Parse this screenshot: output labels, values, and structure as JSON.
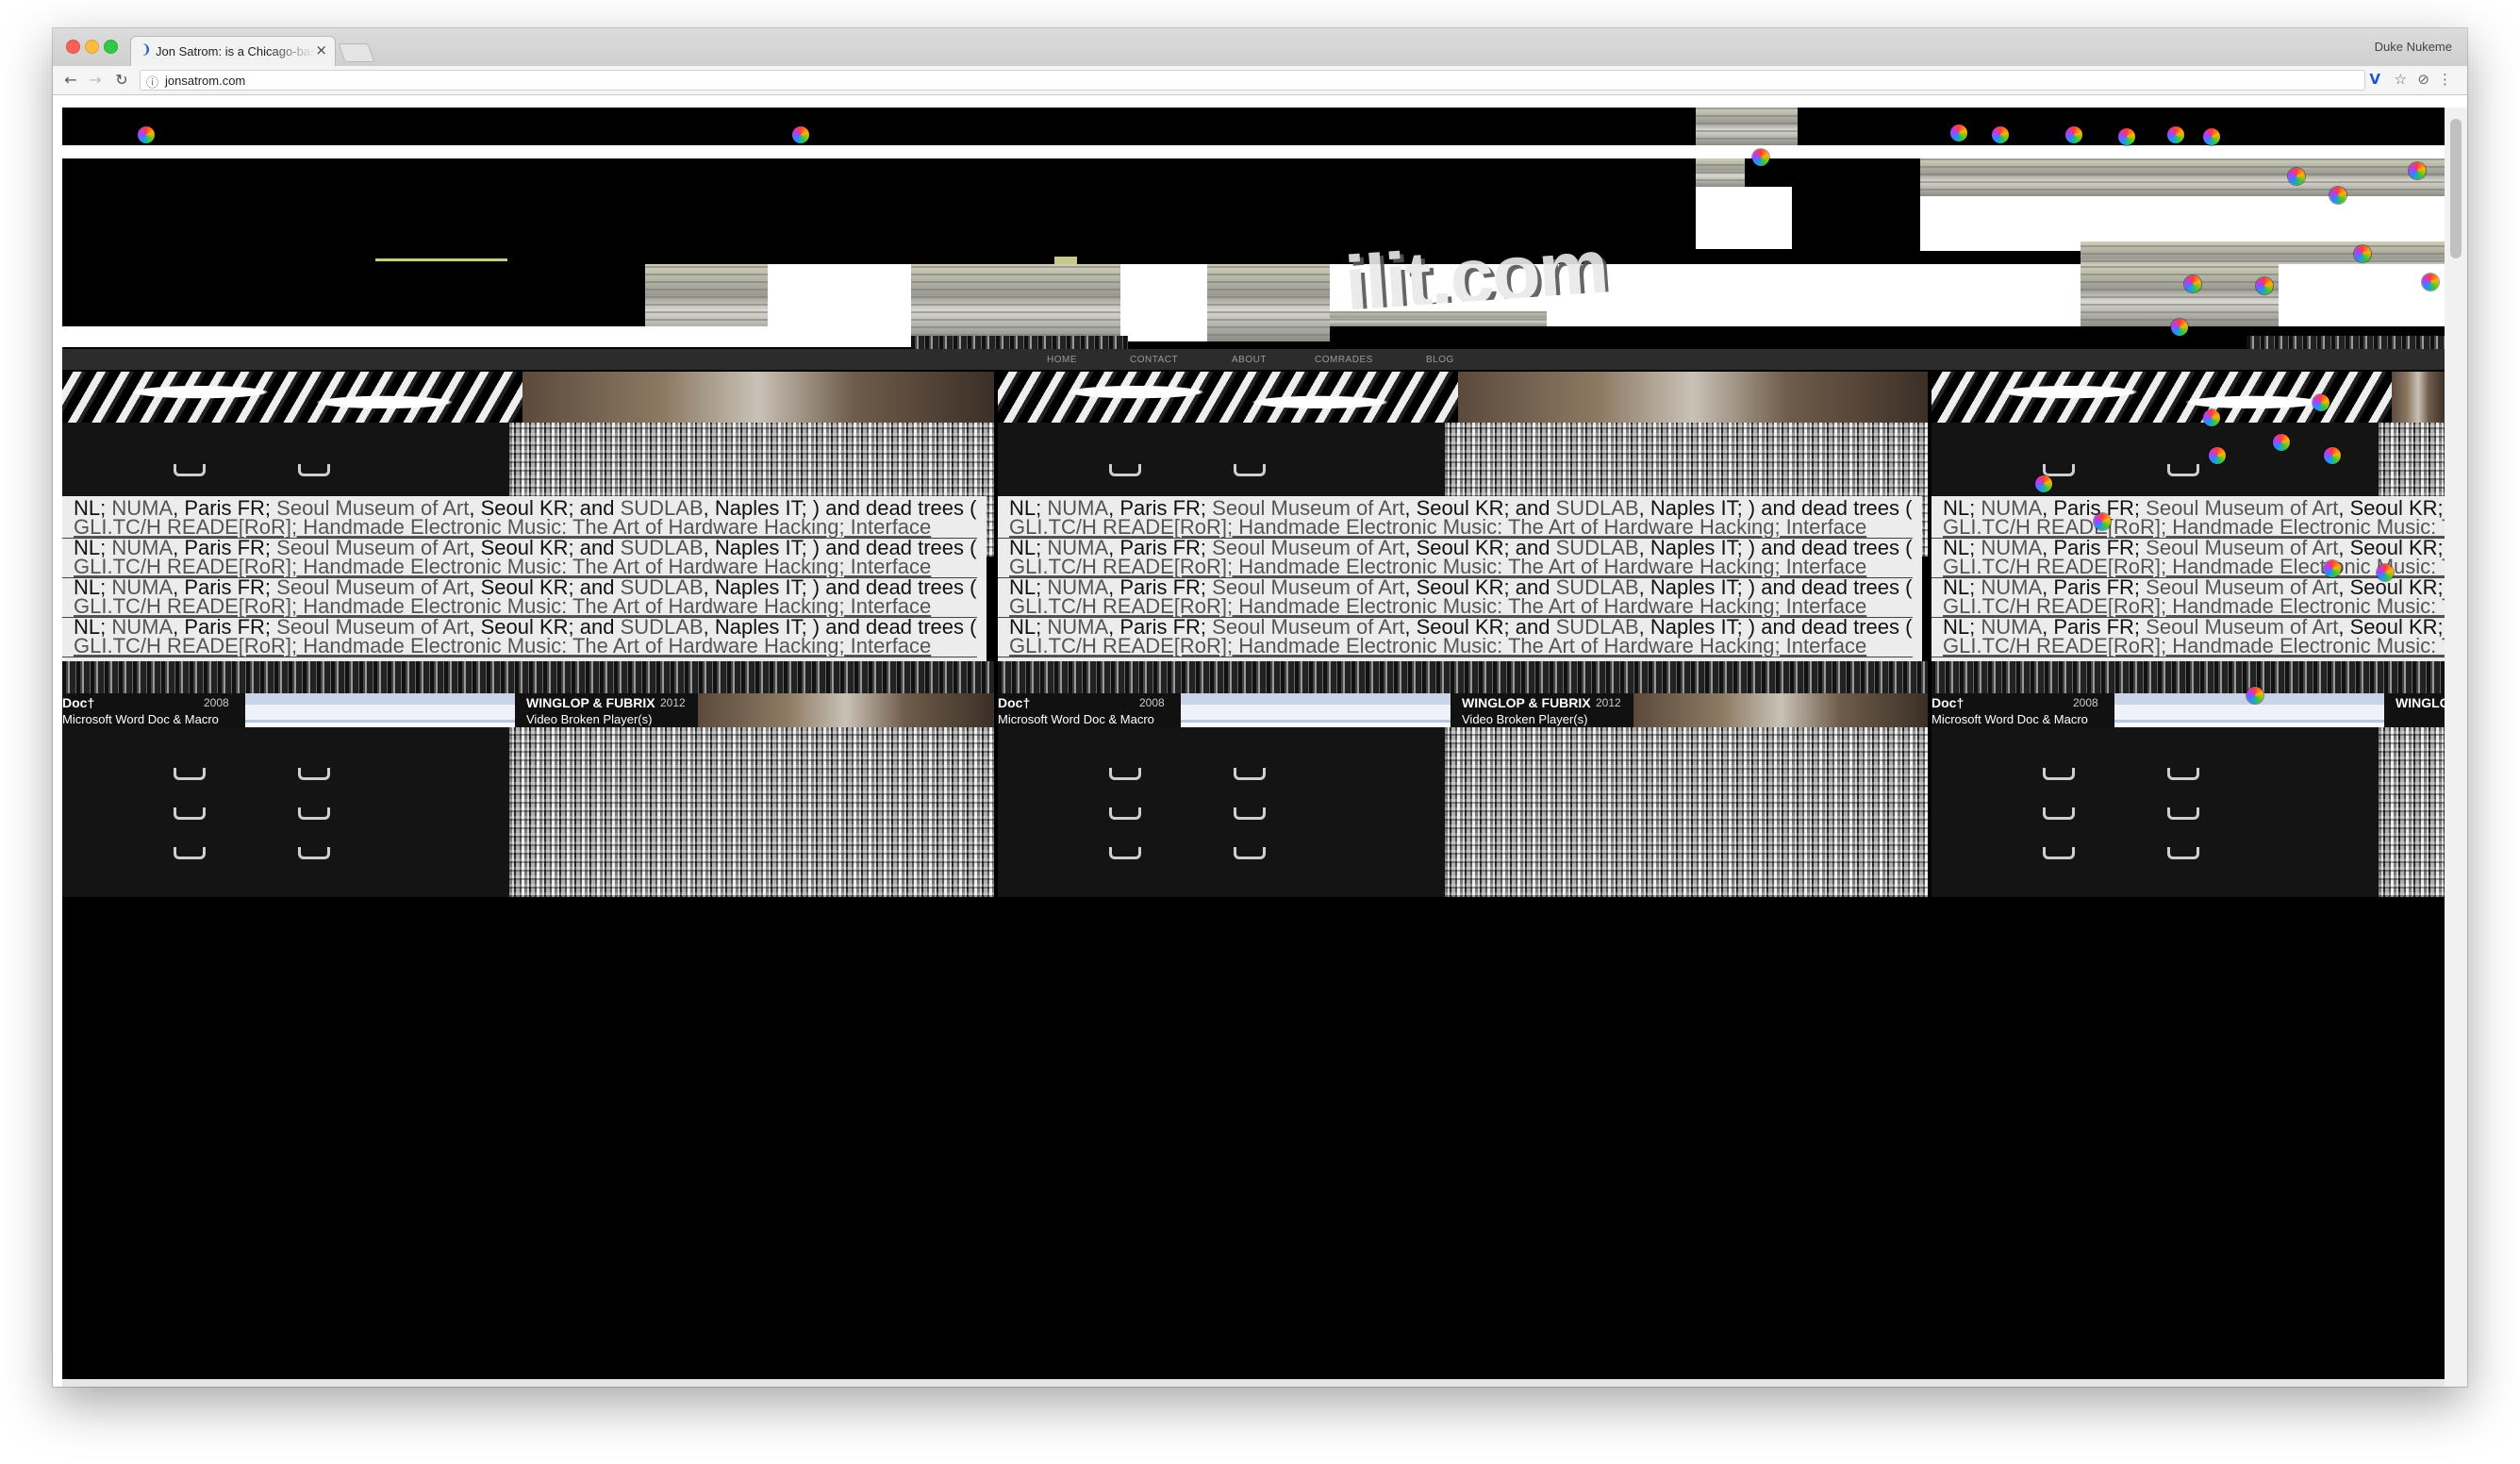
{
  "browser": {
    "tab_title": "Jon Satrom: is a Chicago-based",
    "tab_favicon": "❩",
    "tab_close": "×",
    "profile_name": "Duke Nukeme",
    "url": "jonsatrom.com",
    "icons": {
      "back": "arrow-left-icon",
      "forward": "arrow-right-icon",
      "reload": "reload-icon",
      "info": "info-icon",
      "extension": "v-extension-icon",
      "bookmark": "star-icon",
      "shield": "shield-icon",
      "menu": "kebab-menu-icon"
    },
    "glyphs": {
      "back": "←",
      "forward": "→",
      "reload": "↻",
      "info": "ⓘ",
      "extension": "V",
      "bookmark": "☆",
      "shield": "⊘",
      "menu": "⋮"
    }
  },
  "site": {
    "logo_fragment": "ilit.com",
    "nav": [
      "HOME",
      "CONTACT",
      "ABOUT",
      "COMRADES",
      "BLOG"
    ],
    "text_lines": {
      "line_a": {
        "t1": "NL; ",
        "l1": "NUMA",
        "t2": ", Paris FR; ",
        "l2": "Seoul Museum of Art",
        "t3": ", Seoul KR; and ",
        "l3": "SUDLAB",
        "t4": ", Naples IT; ) and dead trees ("
      },
      "line_b": "GLI.TC/H READE[RoR]; Handmade Electronic Music: The Art of Hardware Hacking; Interface"
    },
    "tiles": {
      "docx_title": "Doc†",
      "docx_year": "2008",
      "docx_sub": "Microsoft Word Doc & Macro",
      "winglop_title": "WINGLOP & FUBRIX",
      "winglop_year": "2012",
      "winglop_sub": "Video Broken Player(s)"
    }
  },
  "colors": {
    "chrome_titlebar": "#d6d6d6",
    "page_background": "#000000",
    "text_panel": "#ececec",
    "link_gray": "#555555",
    "nav_bar": "#2c2c2c"
  }
}
